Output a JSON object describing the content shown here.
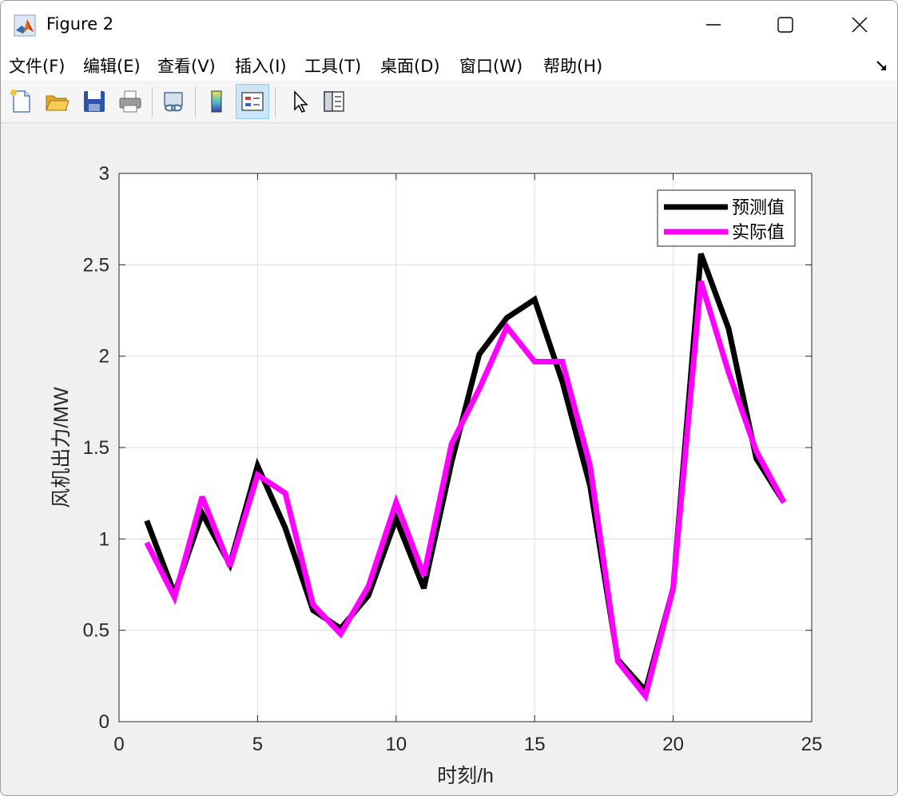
{
  "window": {
    "title": "Figure 2",
    "icon": "matlab-logo-icon",
    "controls": [
      "minimize-icon",
      "maximize-icon",
      "close-icon"
    ]
  },
  "menu": {
    "items": [
      {
        "label": "文件(F)"
      },
      {
        "label": "编辑(E)"
      },
      {
        "label": "查看(V)"
      },
      {
        "label": "插入(I)"
      },
      {
        "label": "工具(T)"
      },
      {
        "label": "桌面(D)"
      },
      {
        "label": "窗口(W)"
      },
      {
        "label": "帮助(H)"
      }
    ]
  },
  "toolbar": {
    "buttons": [
      {
        "icon": "new-figure-icon"
      },
      {
        "icon": "open-file-icon"
      },
      {
        "icon": "save-icon"
      },
      {
        "icon": "print-icon"
      },
      {
        "icon": "link-plot-icon"
      },
      {
        "icon": "colorbar-icon"
      },
      {
        "icon": "legend-icon",
        "active": true
      },
      {
        "icon": "pointer-icon"
      },
      {
        "icon": "property-editor-icon"
      }
    ]
  },
  "chart_data": {
    "type": "line",
    "xlabel": "时刻/h",
    "ylabel": "风机出力/MW",
    "xlim": [
      0,
      25
    ],
    "ylim": [
      0,
      3
    ],
    "xticks": [
      0,
      5,
      10,
      15,
      20,
      25
    ],
    "yticks": [
      0,
      0.5,
      1,
      1.5,
      2,
      2.5,
      3
    ],
    "grid": true,
    "legend_position": "top-right",
    "x": [
      1,
      2,
      3,
      4,
      5,
      6,
      7,
      8,
      9,
      10,
      11,
      12,
      13,
      14,
      15,
      16,
      17,
      18,
      19,
      20,
      21,
      22,
      23,
      24
    ],
    "series": [
      {
        "name": "预测值",
        "color": "#000000",
        "values": [
          1.1,
          0.7,
          1.14,
          0.86,
          1.4,
          1.06,
          0.61,
          0.51,
          0.69,
          1.11,
          0.73,
          1.42,
          2.01,
          2.21,
          2.31,
          1.86,
          1.29,
          0.34,
          0.17,
          0.73,
          2.56,
          2.15,
          1.44,
          1.2
        ]
      },
      {
        "name": "实际值",
        "color": "#ff00ff",
        "values": [
          0.98,
          0.68,
          1.23,
          0.85,
          1.35,
          1.25,
          0.64,
          0.48,
          0.74,
          1.2,
          0.8,
          1.52,
          1.82,
          2.16,
          1.97,
          1.97,
          1.4,
          0.33,
          0.14,
          0.73,
          2.41,
          1.91,
          1.48,
          1.2
        ]
      }
    ]
  },
  "colors": {
    "window_bg": "#f0f0f0",
    "titlebar_bg": "#ffffff",
    "active_tool": "#cce4f7"
  }
}
